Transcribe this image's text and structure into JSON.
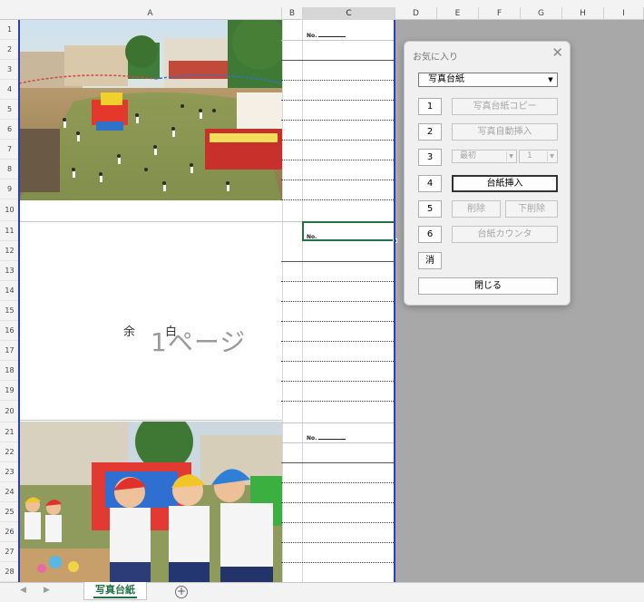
{
  "columns": [
    "A",
    "B",
    "C",
    "D",
    "E",
    "F",
    "G",
    "H",
    "I"
  ],
  "rows": [
    "1",
    "2",
    "3",
    "4",
    "5",
    "6",
    "7",
    "8",
    "9",
    "10",
    "11",
    "12",
    "13",
    "14",
    "15",
    "16",
    "17",
    "18",
    "19",
    "20",
    "21",
    "22",
    "23",
    "24",
    "25",
    "26",
    "27",
    "28"
  ],
  "sheet": {
    "no_label": "No.",
    "blank_char_1": "余",
    "blank_char_2": "白",
    "page_label": "1ページ"
  },
  "dialog": {
    "title": "お気に入り",
    "close": "✕",
    "template_value": "写真台紙",
    "btn_num": [
      "1",
      "2",
      "3",
      "4",
      "5",
      "6"
    ],
    "clear_label": "消",
    "copy_label": "写真台紙コピー",
    "auto_insert_label": "写真自動挿入",
    "first_select": "最初",
    "count_select": "1",
    "insert_label": "台紙挿入",
    "delete_label": "削除",
    "delete_down_label": "下削除",
    "counter_label": "台紙カウンタ",
    "close_label": "閉じる"
  },
  "tabs": {
    "sheet_tab": "写真台紙",
    "add_sheet": "+",
    "prev": "◀",
    "next": "▶"
  },
  "colors": {
    "accent": "#217346",
    "page_border": "#2c3fb8"
  }
}
